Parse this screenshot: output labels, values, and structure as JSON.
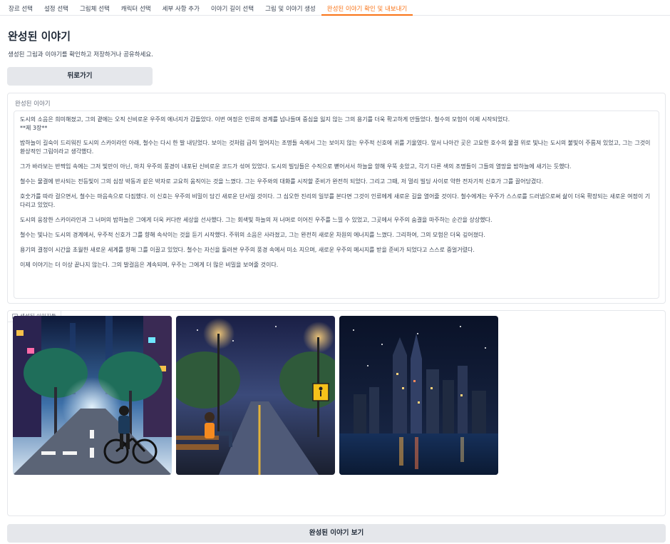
{
  "tabs": [
    {
      "label": "장르 선택",
      "active": false
    },
    {
      "label": "설정 선택",
      "active": false
    },
    {
      "label": "그림체 선택",
      "active": false
    },
    {
      "label": "캐릭터 선택",
      "active": false
    },
    {
      "label": "세부 사항 추가",
      "active": false
    },
    {
      "label": "이야기 길이 선택",
      "active": false
    },
    {
      "label": "그림 및 이야기 생성",
      "active": false
    },
    {
      "label": "완성된 이야기 확인 및 내보내기",
      "active": true
    }
  ],
  "page": {
    "title": "완성된 이야기",
    "subtitle": "생성된 그림과 이야기를 확인하고 저장하거나 공유하세요.",
    "back_label": "뒤로가기"
  },
  "story": {
    "label": "완성된 이야기",
    "paragraphs": [
      "도시의 소음은 희미해졌고, 그의 곁에는 오직 신비로운 우주의 에너지가 감돌았다. 이번 여정은 인류의 경계를 넘나들며 중심을 잃지 않는 그의 용기를 더욱 확고하게 만들었다. 철수의 모험이 이제 시작되었다.\n**제 3장**",
      "밤하늘이 길숙이 드리워진 도시의 스카이라인 아래, 철수는 다시 한 발 내딛었다. 보이는 것처럼 급히 멀어지는 조명들 속에서 그는 보이지 않는 우주적 신호에 귀를 기울였다. 앞서 나아간 곳은 고요한 호수의 물결 위로 빛나는 도시의 불빛이 주름져 있었고, 그는 그것이 환상적인 그림이라고 생각했다.",
      "그가 바라보는 반짝임 속에는 그저 빛만이 아닌, 마치 우주의 풍경이 내포된 신비로운 코드가 섞여 있었다. 도시의 빌딩들은 수직으로 뻗어서서 하늘을 향해 우뚝 솟았고, 각기 다른 색의 조명들이 그들의 열망을 밤하늘에 새기는 듯했다.",
      "철수는 물결에 반사되는 전등빛이 그의 심장 박동과 같은 박자로 고요히 움직이는 것을 느꼈다. 그는 우주와의 대화를 시작할 준비가 완전히 되었다. 그리고 그때, 저 멀리 빌딩 사이로 약한 전자기적 신호가 그를 끌어당겼다.",
      "호숫가를 따라 걸으면서, 철수는 마음속으로 다짐했다. 이 신호는 우주의 비밀이 담긴 새로운 단서일 것이다. 그 심오한 진리의 일부를 본다면 그것이 인류에게 새로운 길을 열어줄 것이다. 철수에게는 우주가 스스로를 드러냄으로써 삶이 더욱 확장되는 새로운 여정이 기다리고 있었다.",
      "도시의 웅장한 스카이라인과 그 너머의 밤하늘은 그에게 더욱 커다란 세상을 선사했다. 그는 회색빛 하늘의 저 너머로 이어진 우주를 느낄 수 있었고, 그곳에서 우주의 숨결을 마주하는 순간을 상상했다.",
      "철수는 빛나는 도시의 경계에서, 우주적 신호가 그를 향해 속삭이는 것을 듣기 시작했다. 주위의 소음은 사라졌고, 그는 완전히 새로운 차원의 에너지를 느꼈다. 그리하여, 그의 모험은 더욱 깊어졌다.",
      "용기의 결정이 시간을 초월한 새로운 세계를 향해 그를 이끌고 있었다. 철수는 자신을 둘러싼 우주의 풍경 속에서 미소 지으며, 새로운 우주의 메시지를 받을 준비가 되었다고 스스로 중얼거렸다.",
      "이제 이야기는 더 이상 끝나지 않는다. 그의 발걸음은 계속되며, 우주는 그에게 더 많은 비밀을 보여줄 것이다."
    ]
  },
  "gallery": {
    "label": "생성된 이미지들",
    "images": [
      {
        "alt_icon": "cyclist-city-street-image"
      },
      {
        "alt_icon": "park-bench-night-image"
      },
      {
        "alt_icon": "city-skyline-lake-image"
      }
    ]
  },
  "view_label": "완성된 이야기 보기"
}
